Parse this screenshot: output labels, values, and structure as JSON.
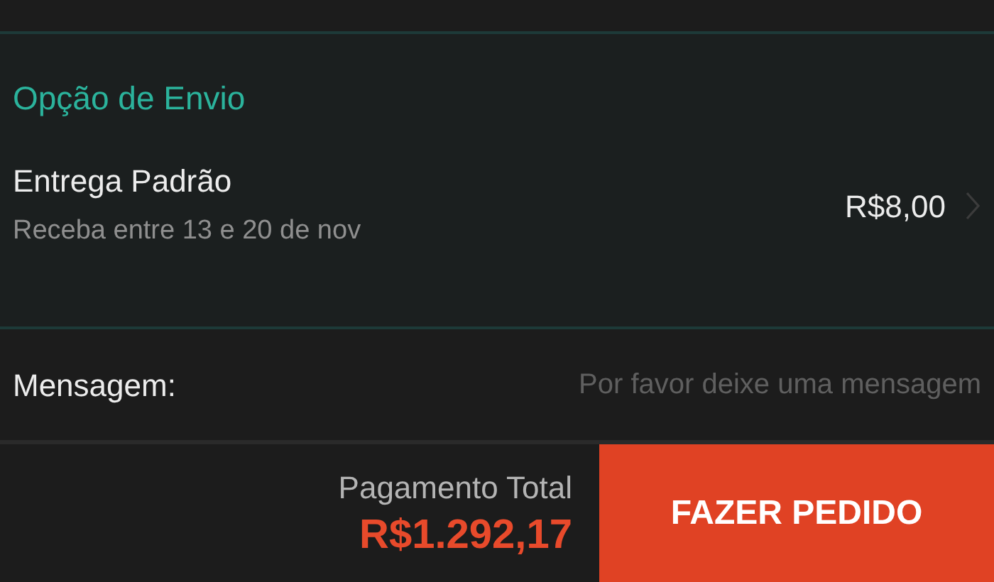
{
  "shipping": {
    "heading": "Opção de Envio",
    "option": {
      "name": "Entrega Padrão",
      "estimate": "Receba entre 13 e 20 de nov",
      "price": "R$8,00"
    }
  },
  "message": {
    "label": "Mensagem:",
    "placeholder": "Por favor deixe uma mensagem"
  },
  "footer": {
    "total_label": "Pagamento Total",
    "total": "R$1.292,17",
    "button": "FAZER PEDIDO"
  }
}
